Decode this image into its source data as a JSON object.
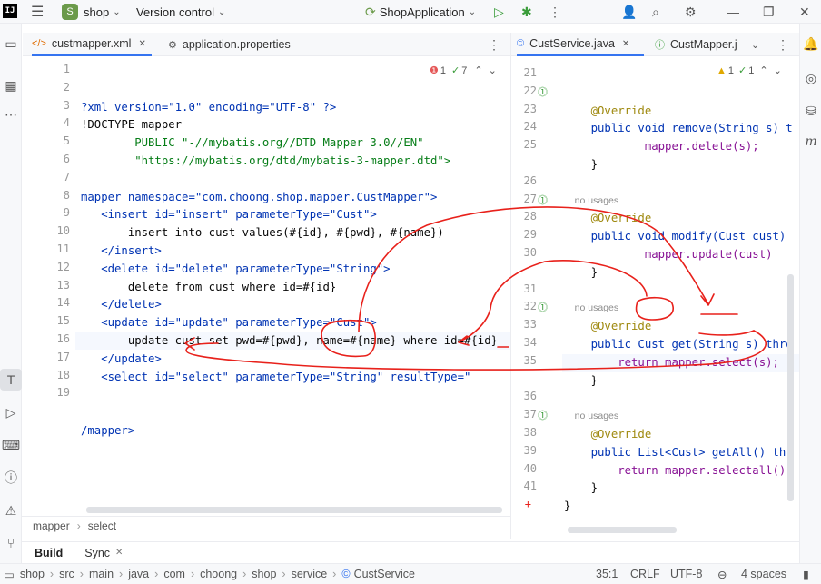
{
  "titlebar": {
    "logo": "IJ",
    "project_badge": "S",
    "project_name": "shop",
    "vcs": "Version control",
    "run_config": "ShopApplication"
  },
  "left_tabs": [
    {
      "label": "custmapper.xml",
      "icon": "xml-icon"
    },
    {
      "label": "application.properties",
      "icon": "properties-icon"
    }
  ],
  "right_tabs": [
    {
      "label": "CustService.java",
      "icon": "java-class-icon"
    },
    {
      "label": "CustMapper.j",
      "icon": "interface-icon"
    }
  ],
  "left_indicators": {
    "errors": "1",
    "warnings": "7"
  },
  "right_indicators": {
    "warnings": "1",
    "ok": "1"
  },
  "left_editor": {
    "line_numbers": [
      "1",
      "2",
      "3",
      "4",
      "5",
      "6",
      "7",
      "8",
      "9",
      "10",
      "11",
      "12",
      "13",
      "14",
      "15",
      "16",
      "17",
      "18",
      "19"
    ],
    "lines": [
      "?xml version=\"1.0\" encoding=\"UTF-8\" ?>",
      "!DOCTYPE mapper",
      "        PUBLIC \"-//mybatis.org//DTD Mapper 3.0//EN\"",
      "        \"https://mybatis.org/dtd/mybatis-3-mapper.dtd\">",
      "",
      "mapper namespace=\"com.choong.shop.mapper.CustMapper\">",
      "   <insert id=\"insert\" parameterType=\"Cust\">",
      "       insert into cust values(#{id}, #{pwd}, #{name})",
      "   </insert>",
      "   <delete id=\"delete\" parameterType=\"String\">",
      "       delete from cust where id=#{id}",
      "   </delete>",
      "   <update id=\"update\" parameterType=\"Cust\">",
      "       update cust set pwd=#{pwd}, name=#{name} where id=#{id}",
      "   </update>",
      "   <select id=\"select\" parameterType=\"String\" resultType=\"",
      "",
      "",
      "/mapper>"
    ]
  },
  "right_editor": {
    "rows": [
      {
        "ln": "21",
        "text": "    @Override",
        "kind": "ann"
      },
      {
        "ln": "22",
        "text": "    public void remove(String s) th",
        "kind": "code",
        "gutter_icon": true
      },
      {
        "ln": "23",
        "text": "            mapper.delete(s);",
        "kind": "code"
      },
      {
        "ln": "24",
        "text": "    }",
        "kind": "code"
      },
      {
        "ln": "25",
        "text": "",
        "kind": "code"
      },
      {
        "ln": "",
        "text": "    no usages",
        "kind": "hint"
      },
      {
        "ln": "26",
        "text": "    @Override",
        "kind": "ann"
      },
      {
        "ln": "27",
        "text": "    public void modify(Cust cust) t",
        "kind": "code",
        "gutter_icon": true
      },
      {
        "ln": "28",
        "text": "            mapper.update(cust)",
        "kind": "code"
      },
      {
        "ln": "29",
        "text": "    }",
        "kind": "code"
      },
      {
        "ln": "30",
        "text": "",
        "kind": "code"
      },
      {
        "ln": "",
        "text": "    no usages",
        "kind": "hint"
      },
      {
        "ln": "31",
        "text": "    @Override",
        "kind": "ann"
      },
      {
        "ln": "32",
        "text": "    public Cust get(String s) throw",
        "kind": "code",
        "gutter_icon": true
      },
      {
        "ln": "33",
        "text": "        return mapper.select(s);",
        "kind": "code"
      },
      {
        "ln": "34",
        "text": "    }",
        "kind": "code"
      },
      {
        "ln": "35",
        "text": "",
        "kind": "code"
      },
      {
        "ln": "",
        "text": "    no usages",
        "kind": "hint"
      },
      {
        "ln": "36",
        "text": "    @Override",
        "kind": "ann"
      },
      {
        "ln": "37",
        "text": "    public List<Cust> getAll() thro",
        "kind": "code",
        "gutter_icon": true
      },
      {
        "ln": "38",
        "text": "        return mapper.selectall();",
        "kind": "code"
      },
      {
        "ln": "39",
        "text": "    }",
        "kind": "code"
      },
      {
        "ln": "40",
        "text": "}",
        "kind": "code"
      },
      {
        "ln": "41",
        "text": "",
        "kind": "code"
      }
    ]
  },
  "breadcrumb": [
    "mapper",
    "select"
  ],
  "bottom_tabs": [
    "Build",
    "Sync"
  ],
  "status_path": [
    "shop",
    "src",
    "main",
    "java",
    "com",
    "choong",
    "shop",
    "service",
    "CustService"
  ],
  "status_right": {
    "position": "35:1",
    "line_sep": "CRLF",
    "encoding": "UTF-8",
    "indent": "4 spaces"
  },
  "colors": {
    "accent": "#3574f0",
    "annotation_ink": "#e8211b",
    "background": "#ffffff",
    "chrome": "#f7f8fa"
  }
}
